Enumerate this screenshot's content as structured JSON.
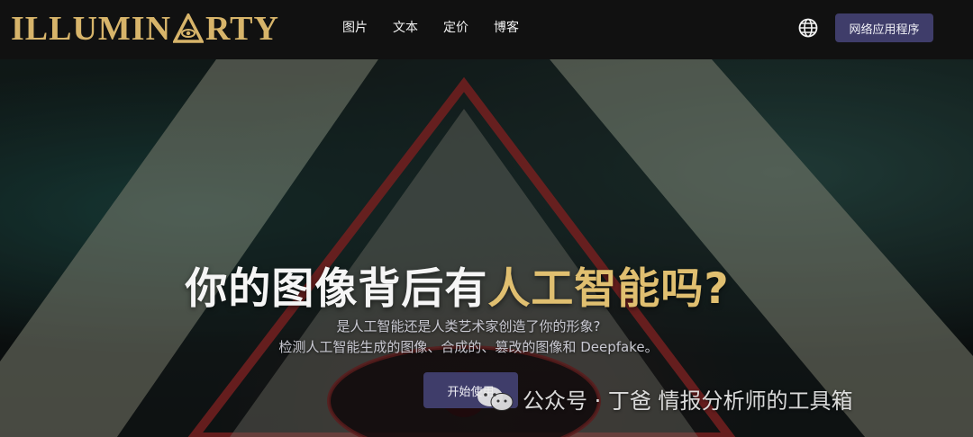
{
  "brand": {
    "logo_left": "ILLUMIN",
    "logo_right": "RTY",
    "colors": {
      "gold": "#d7b46a",
      "button": "#3f3d6a"
    }
  },
  "nav": {
    "links": [
      "图片",
      "文本",
      "定价",
      "博客"
    ],
    "language_icon": "globe-icon",
    "app_button_label": "网络应用程序"
  },
  "hero": {
    "headline_white": "你的图像背后有",
    "headline_gold": "人工智能吗?",
    "subtitle_line1": "是人工智能还是人类艺术家创造了你的形象?",
    "subtitle_line2": "检测人工智能生成的图像、合成的、篡改的图像和 Deepfake。",
    "start_button_label": "开始使用"
  },
  "watermark": {
    "icon": "wechat-icon",
    "text": "公众号 · 丁爸 情报分析师的工具箱"
  }
}
